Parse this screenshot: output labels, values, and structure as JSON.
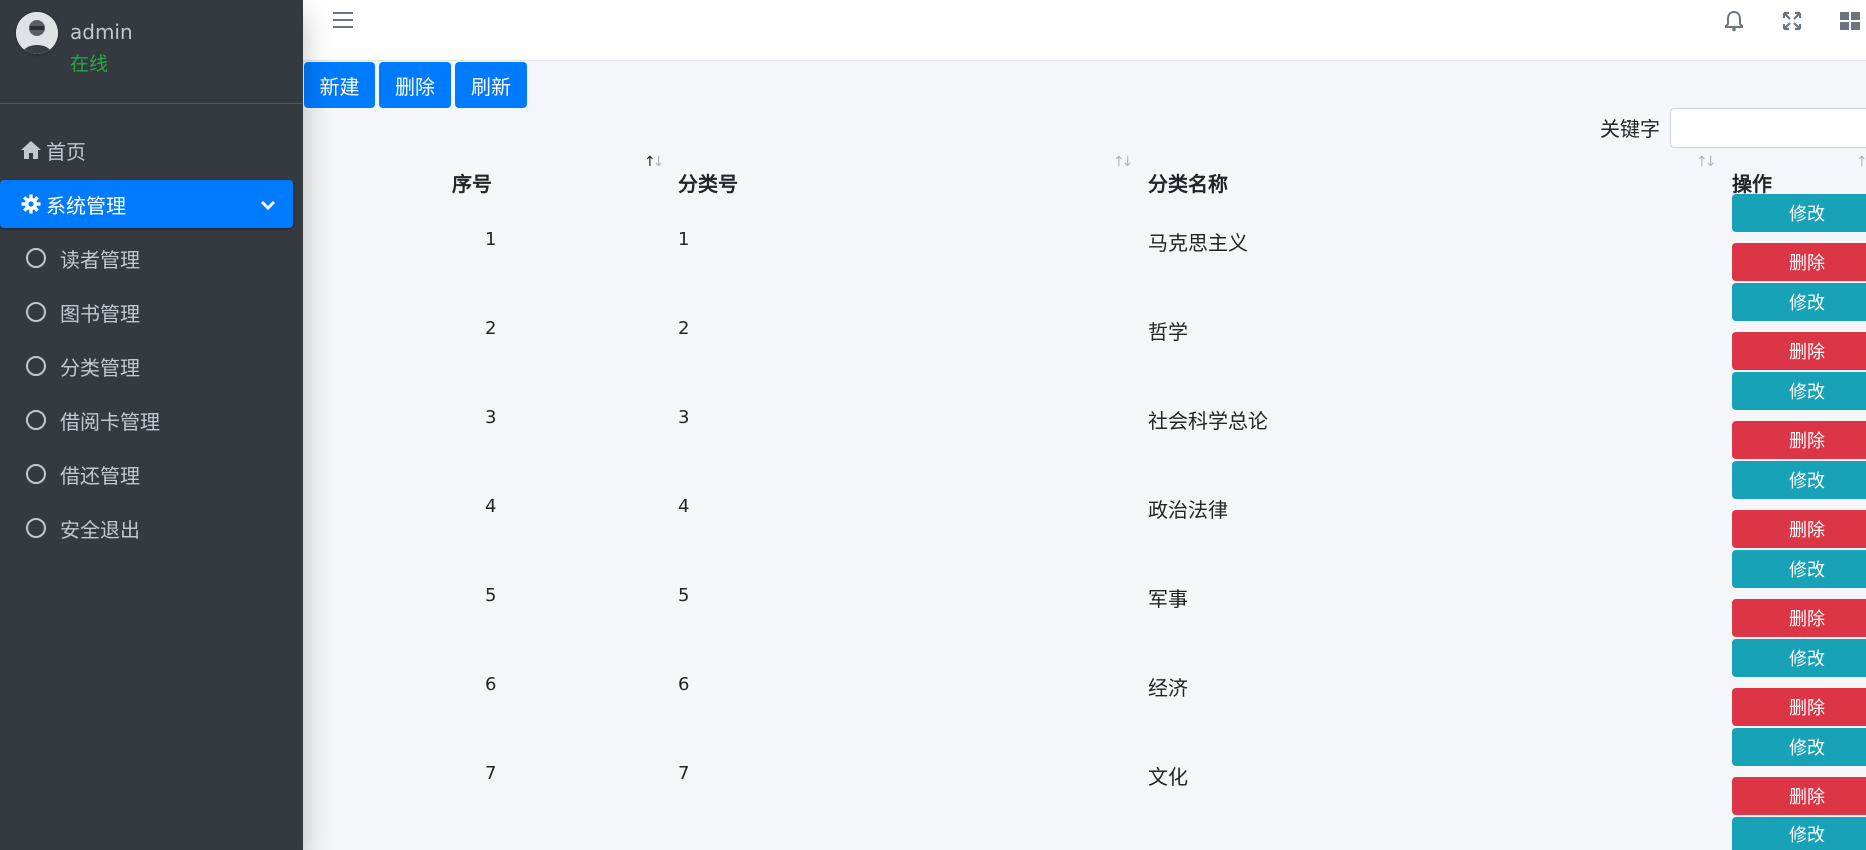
{
  "user": {
    "name": "admin",
    "status": "在线"
  },
  "nav": {
    "home": "首页",
    "system": "系统管理",
    "items": [
      {
        "label": "读者管理"
      },
      {
        "label": "图书管理"
      },
      {
        "label": "分类管理"
      },
      {
        "label": "借阅卡管理"
      },
      {
        "label": "借还管理"
      },
      {
        "label": "安全退出"
      }
    ]
  },
  "toolbar": {
    "new_label": "新建",
    "delete_label": "删除",
    "refresh_label": "刷新"
  },
  "search": {
    "label": "关键字",
    "value": ""
  },
  "table": {
    "columns": [
      "序号",
      "分类号",
      "分类名称",
      "操作"
    ],
    "rows": [
      {
        "idx": "1",
        "code": "1",
        "name": "马克思主义"
      },
      {
        "idx": "2",
        "code": "2",
        "name": "哲学"
      },
      {
        "idx": "3",
        "code": "3",
        "name": "社会科学总论"
      },
      {
        "idx": "4",
        "code": "4",
        "name": "政治法律"
      },
      {
        "idx": "5",
        "code": "5",
        "name": "军事"
      },
      {
        "idx": "6",
        "code": "6",
        "name": "经济"
      },
      {
        "idx": "7",
        "code": "7",
        "name": "文化"
      }
    ],
    "edit_label": "修改",
    "delete_label": "删除"
  },
  "colors": {
    "primary": "#007bff",
    "info": "#17a2b8",
    "danger": "#dc3545",
    "sidebar": "#343a40",
    "online": "#28a745"
  },
  "icons": [
    "home-icon",
    "gear-icon",
    "chevron-down-icon",
    "circle-icon",
    "hamburger-icon",
    "bell-icon",
    "fullscreen-icon",
    "grid-icon",
    "sort-icon"
  ]
}
